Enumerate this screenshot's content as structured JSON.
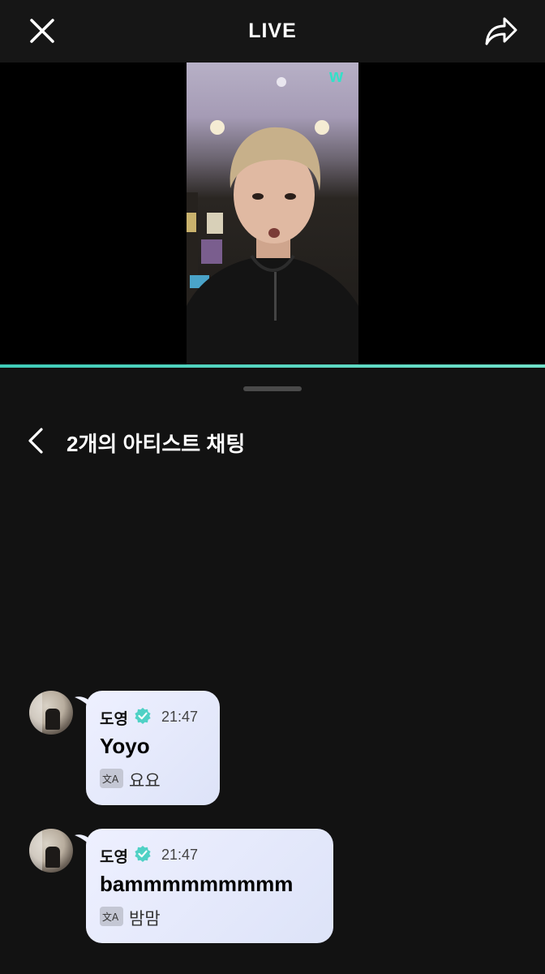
{
  "header": {
    "title": "LIVE"
  },
  "video": {
    "watermark": "w",
    "progress_fraction": 1.0
  },
  "chat": {
    "title": "2개의 아티스트 채팅",
    "messages": [
      {
        "sender": "도영",
        "time": "21:47",
        "text": "Yoyo",
        "translation": "요요"
      },
      {
        "sender": "도영",
        "time": "21:47",
        "text": "bammmmmmmmm",
        "translation": "밤맘"
      }
    ]
  },
  "colors": {
    "accent": "#3fcbb8",
    "verified": "#4fd1c5",
    "bubble": "#e5e9fb"
  }
}
